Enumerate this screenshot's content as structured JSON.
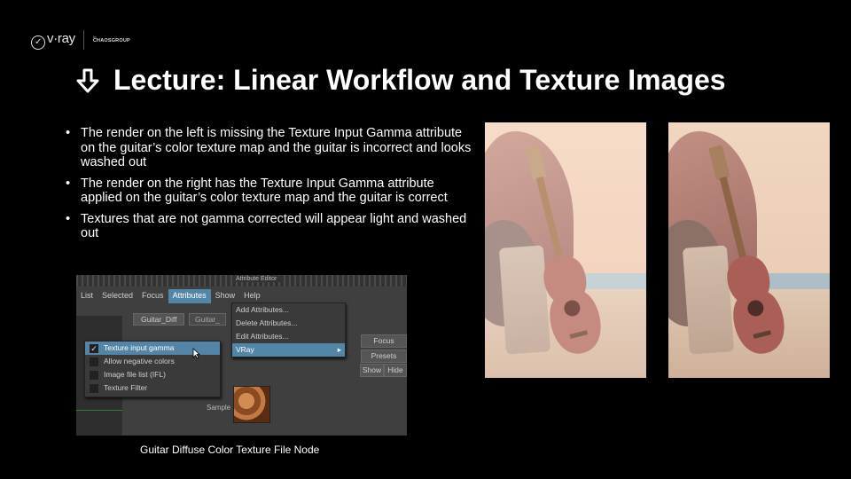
{
  "logo": {
    "vray": "v·ray",
    "by": "by",
    "chaos": "CHAOSGROUP"
  },
  "title": "Lecture: Linear Workflow and Texture Images",
  "bullets": [
    "The render on the left is missing the Texture Input Gamma attribute on the guitar’s color texture map and the guitar is incorrect and looks washed out",
    "The render on the right has the Texture Input Gamma attribute applied on the guitar’s color texture map and the guitar is correct",
    "Textures that are not gamma corrected will appear light and washed out"
  ],
  "bullet_char": "•",
  "maya": {
    "window_title": "Attribute Editor",
    "menus": [
      "List",
      "Selected",
      "Focus",
      "Attributes",
      "Show",
      "Help"
    ],
    "active_menu_index": 3,
    "node_tab": "Guitar_Diff",
    "node_tab2": "Guitar_",
    "attributes_menu": [
      "Add Attributes...",
      "Delete Attributes...",
      "Edit Attributes...",
      "VRay"
    ],
    "vray_submenu": [
      "Texture input gamma",
      "Allow negative colors",
      "Image file list (IFL)",
      "Texture Filter"
    ],
    "checked_index": 0,
    "right_buttons": [
      "Focus",
      "Presets",
      "Show",
      "Hide"
    ],
    "sample_label": "Sample"
  },
  "caption": "Guitar Diffuse Color Texture File Node",
  "colors": {
    "accent": "#5285a6",
    "background": "#000000"
  }
}
